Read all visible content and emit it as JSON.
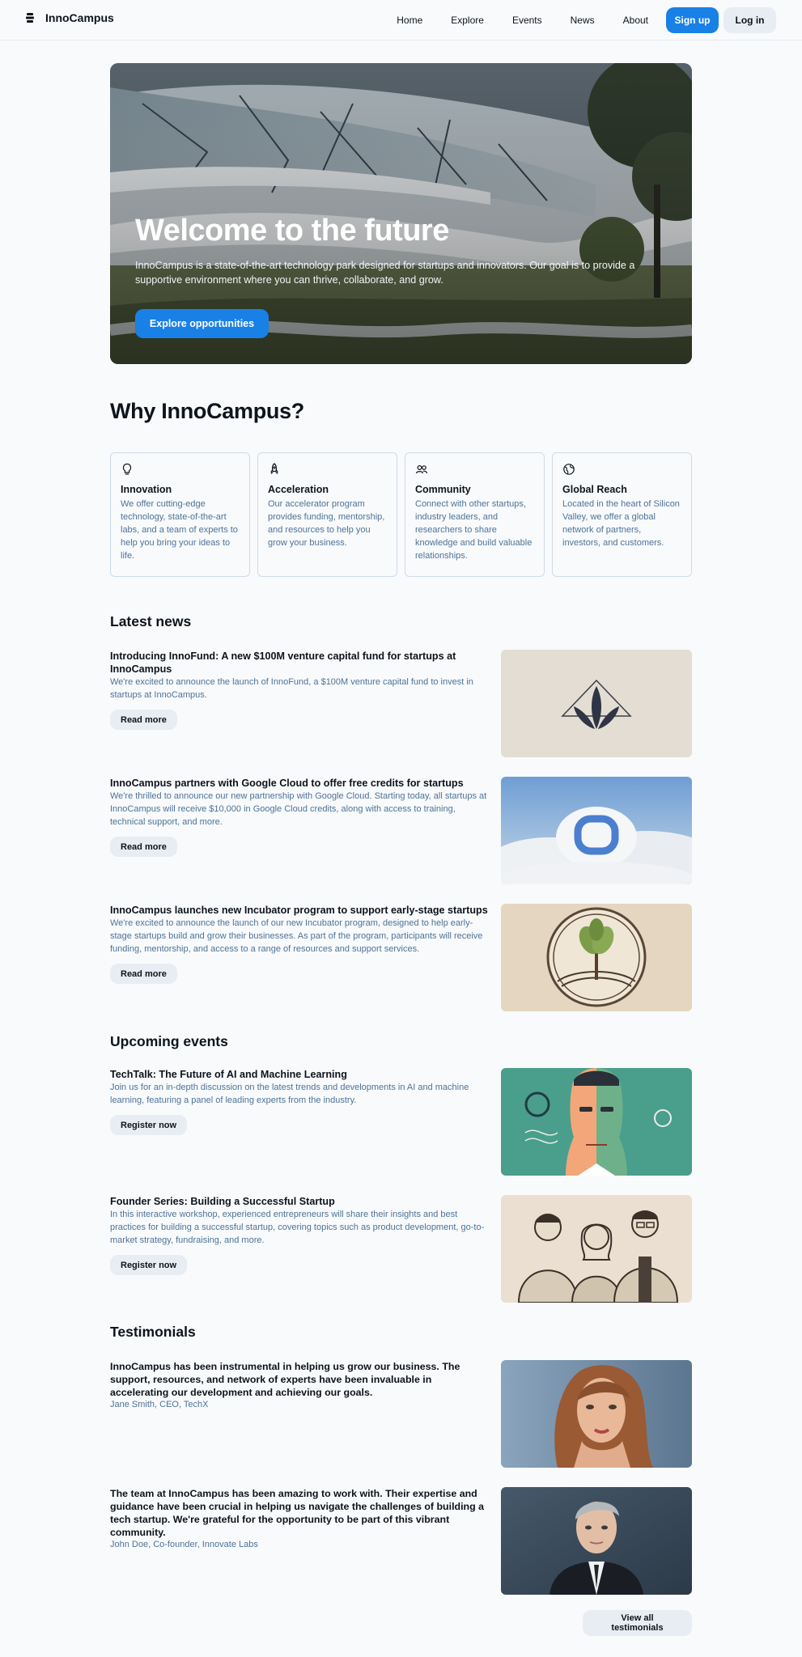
{
  "brand": {
    "name": "InnoCampus"
  },
  "nav": {
    "links": [
      "Home",
      "Explore",
      "Events",
      "News",
      "About"
    ],
    "signup": "Sign up",
    "login": "Log in"
  },
  "hero": {
    "title": "Welcome to the future",
    "text": "InnoCampus is a state-of-the-art technology park designed for startups and innovators. Our goal is to provide a supportive environment where you can thrive, collaborate, and grow.",
    "cta": "Explore opportunities"
  },
  "why": {
    "heading": "Why InnoCampus?",
    "features": [
      {
        "icon": "lightbulb-icon",
        "title": "Innovation",
        "desc": "We offer cutting-edge technology, state-of-the-art labs, and a team of experts to help you bring your ideas to life."
      },
      {
        "icon": "rocket-icon",
        "title": "Acceleration",
        "desc": "Our accelerator program provides funding, mentorship, and resources to help you grow your business."
      },
      {
        "icon": "users-icon",
        "title": "Community",
        "desc": "Connect with other startups, industry leaders, and researchers to share knowledge and build valuable relationships."
      },
      {
        "icon": "globe-icon",
        "title": "Global Reach",
        "desc": "Located in the heart of Silicon Valley, we offer a global network of partners, investors, and customers."
      }
    ]
  },
  "news": {
    "heading": "Latest news",
    "items": [
      {
        "title": "Introducing InnoFund: A new $100M venture capital fund for startups at InnoCampus",
        "desc": "We're excited to announce the launch of InnoFund, a $100M venture capital fund to invest in startups at InnoCampus.",
        "button": "Read more"
      },
      {
        "title": "InnoCampus partners with Google Cloud to offer free credits for startups",
        "desc": "We're thrilled to announce our new partnership with Google Cloud. Starting today, all startups at InnoCampus will receive $10,000 in Google Cloud credits, along with access to training, technical support, and more.",
        "button": "Read more"
      },
      {
        "title": "InnoCampus launches new Incubator program to support early-stage startups",
        "desc": "We're excited to announce the launch of our new Incubator program, designed to help early-stage startups build and grow their businesses. As part of the program, participants will receive funding, mentorship, and access to a range of resources and support services.",
        "button": "Read more"
      }
    ]
  },
  "events": {
    "heading": "Upcoming events",
    "items": [
      {
        "title": "TechTalk: The Future of AI and Machine Learning",
        "desc": "Join us for an in-depth discussion on the latest trends and developments in AI and machine learning, featuring a panel of leading experts from the industry.",
        "button": "Register now"
      },
      {
        "title": "Founder Series: Building a Successful Startup",
        "desc": "In this interactive workshop, experienced entrepreneurs will share their insights and best practices for building a successful startup, covering topics such as product development, go-to-market strategy, fundraising, and more.",
        "button": "Register now"
      }
    ]
  },
  "testimonials": {
    "heading": "Testimonials",
    "items": [
      {
        "quote": "InnoCampus has been instrumental in helping us grow our business. The support, resources, and network of experts have been invaluable in accelerating our development and achieving our goals.",
        "author": "Jane Smith, CEO, TechX"
      },
      {
        "quote": "The team at InnoCampus has been amazing to work with. Their expertise and guidance have been crucial in helping us navigate the challenges of building a tech startup. We're grateful for the opportunity to be part of this vibrant community.",
        "author": "John Doe, Co-founder, Innovate Labs"
      }
    ],
    "view_all": "View all testimonials"
  },
  "colors": {
    "primary": "#1980e6",
    "secondary": "#e7edf3",
    "muted_text": "#4e7397",
    "text": "#0e141b",
    "border": "#d0dbe7"
  }
}
